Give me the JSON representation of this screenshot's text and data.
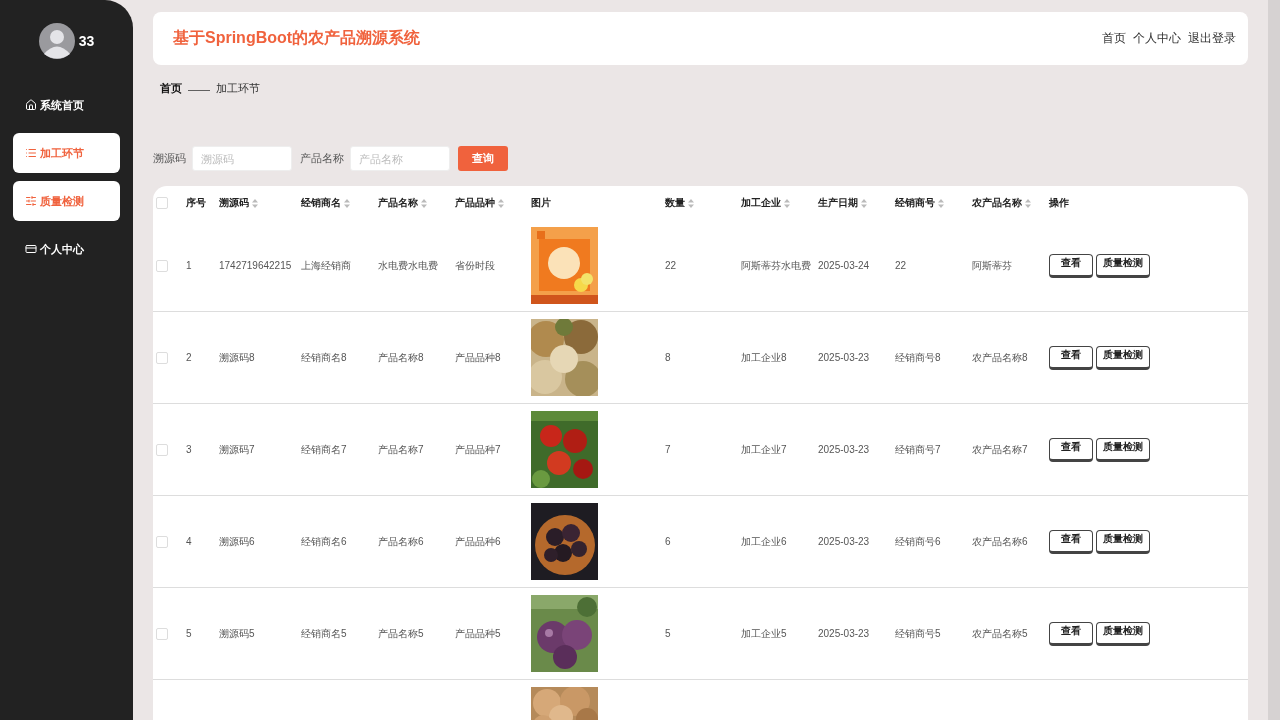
{
  "sidebar": {
    "user": {
      "name": "33"
    },
    "items": [
      {
        "label": "系统首页",
        "kind": "home",
        "highlighted": false
      },
      {
        "label": "加工环节",
        "kind": "list",
        "highlighted": true
      },
      {
        "label": "质量检测",
        "kind": "sliders",
        "highlighted": true
      },
      {
        "label": "个人中心",
        "kind": "card",
        "highlighted": false
      }
    ]
  },
  "header": {
    "title": "基于SpringBoot的农产品溯源系统",
    "links": [
      "首页",
      "个人中心",
      "退出登录"
    ]
  },
  "breadcrumb": {
    "home": "首页",
    "separator": "——",
    "current": "加工环节"
  },
  "search": {
    "fields": [
      {
        "label": "溯源码",
        "placeholder": "溯源码"
      },
      {
        "label": "产品名称",
        "placeholder": "产品名称"
      }
    ],
    "button": "查询"
  },
  "table": {
    "select_all_checked": false,
    "columns": [
      {
        "label": "序号",
        "sortable": false,
        "kind": "text"
      },
      {
        "label": "溯源码",
        "sortable": true,
        "kind": "text"
      },
      {
        "label": "经销商名",
        "sortable": true,
        "kind": "text"
      },
      {
        "label": "产品名称",
        "sortable": true,
        "kind": "text"
      },
      {
        "label": "产品品种",
        "sortable": true,
        "kind": "text"
      },
      {
        "label": "图片",
        "sortable": false
      },
      {
        "label": "数量",
        "sortable": true,
        "kind": "text"
      },
      {
        "label": "加工企业",
        "sortable": true,
        "kind": "text"
      },
      {
        "label": "生产日期",
        "sortable": true,
        "kind": "text"
      },
      {
        "label": "经销商号",
        "sortable": true,
        "kind": "text"
      },
      {
        "label": "农产品名称",
        "sortable": true,
        "kind": "text"
      },
      {
        "label": "操作",
        "sortable": false,
        "kind": "actions"
      }
    ],
    "rows": [
      {
        "checked": false,
        "cells": [
          "1",
          "1742719642215",
          "上海经销商",
          "水电费水电费",
          "省份时段",
          "",
          "22",
          "阿斯蒂芬水电费",
          "2025-03-24",
          "22",
          "阿斯蒂芬"
        ],
        "actions": [
          "查看",
          "质量检测"
        ]
      },
      {
        "checked": false,
        "cells": [
          "2",
          "溯源码8",
          "经销商名8",
          "产品名称8",
          "产品品种8",
          "",
          "8",
          "加工企业8",
          "2025-03-23",
          "经销商号8",
          "农产品名称8"
        ],
        "actions": [
          "查看",
          "质量检测"
        ]
      },
      {
        "checked": false,
        "cells": [
          "3",
          "溯源码7",
          "经销商名7",
          "产品名称7",
          "产品品种7",
          "",
          "7",
          "加工企业7",
          "2025-03-23",
          "经销商号7",
          "农产品名称7"
        ],
        "actions": [
          "查看",
          "质量检测"
        ]
      },
      {
        "checked": false,
        "cells": [
          "4",
          "溯源码6",
          "经销商名6",
          "产品名称6",
          "产品品种6",
          "",
          "6",
          "加工企业6",
          "2025-03-23",
          "经销商号6",
          "农产品名称6"
        ],
        "actions": [
          "查看",
          "质量检测"
        ]
      },
      {
        "checked": false,
        "cells": [
          "5",
          "溯源码5",
          "经销商名5",
          "产品名称5",
          "产品品种5",
          "",
          "5",
          "加工企业5",
          "2025-03-23",
          "经销商号5",
          "农产品名称5"
        ],
        "actions": [
          "查看",
          "质量检测"
        ]
      }
    ]
  }
}
